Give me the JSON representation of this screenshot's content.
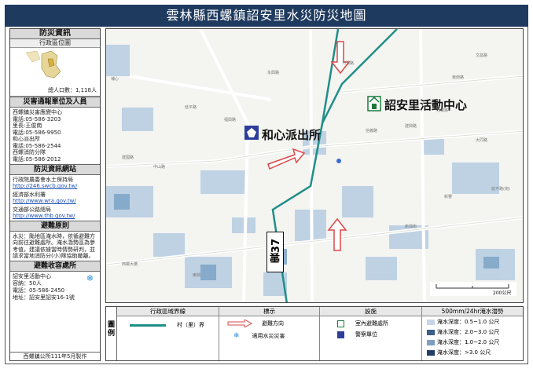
{
  "title": "雲林縣西螺鎮詔安里水災防災地圖",
  "left_panel": {
    "header": "防災資訊",
    "location_sub": "行政區位圖",
    "population": "總人口數：1,118人",
    "contacts_header": "災害通報單位及人員",
    "contacts": [
      "西螺鎮災害應變中心",
      "電話:05-586-3203",
      "里長:王俊南",
      "電話:05-586-9950",
      "和心派出所",
      "電話:05-586-2544",
      "西螺消防分隊",
      "電話:05-586-2012"
    ],
    "sites_header": "防災資訊網站",
    "sites": [
      {
        "name": "行政院農委會水土保持局",
        "url": "http://246.swcb.gov.tw/"
      },
      {
        "name": "經濟部水利署",
        "url": "http://www.wra.gov.tw/"
      },
      {
        "name": "交通部公路總局",
        "url": "http://www.thb.gov.tw/"
      }
    ],
    "principle_header": "避難原則",
    "principle_text": "水災：颱地區淹水時，依循避難方向前往避難處所。淹水潛勢區為參考值，建議依據當時情勢研判，並請求當地消防分(小)隊協助撤離。",
    "shelter_header": "避難收容處所",
    "shelter": {
      "name": "詔安里活動中心",
      "capacity": "容納：50人",
      "phone": "電話：05-586-2450",
      "address": "地址：詔安里詔安16-1號"
    },
    "maker": "西螺鎮公所111年5月製作"
  },
  "map": {
    "center_label": "詔安里活動中心",
    "police_label": "和心派出所",
    "road_number": "雲37",
    "scale_text": "200公尺",
    "small_labels": [
      "永興路",
      "延平路",
      "東南路",
      "建興路",
      "中山路",
      "大同路",
      "建國路",
      "信義路",
      "光復路",
      "河濱路",
      "文昌路",
      "西螺大橋",
      "福興路",
      "新興街",
      "延平路(南)",
      "埔心",
      "東興",
      "新豐"
    ],
    "icons": [
      "activity-center-icon",
      "police-station-icon",
      "evacuation-arrow-icon",
      "flood-rescue-icon"
    ],
    "colors": {
      "boundary": "#1f8f88",
      "flood_light": "#b5cde2",
      "flood_mid": "#7fa6c8",
      "arrow": "#d94848"
    }
  },
  "legend": {
    "caption": "圖例",
    "boundary_header": "行政區域界線",
    "boundary_item": "村（里）界",
    "symbols_header": "標示",
    "evac_direction": "避難方向",
    "flood_rescue": "適用水災災害",
    "facility_header": "設施",
    "shelter_facility": "室內避難處所",
    "police_unit": "警察單位",
    "flood_header": "500mm/24hr淹水潛勢",
    "flood_levels": [
      {
        "label": "淹水深度：0.5~1.0 公尺",
        "color": "#c6d6e6"
      },
      {
        "label": "淹水深度：2.0~3.0 公尺",
        "color": "#3c5f8a"
      },
      {
        "label": "淹水深度：1.0~2.0 公尺",
        "color": "#7f9fc2"
      },
      {
        "label": "淹水深度：>3.0 公尺",
        "color": "#233e66"
      }
    ]
  }
}
